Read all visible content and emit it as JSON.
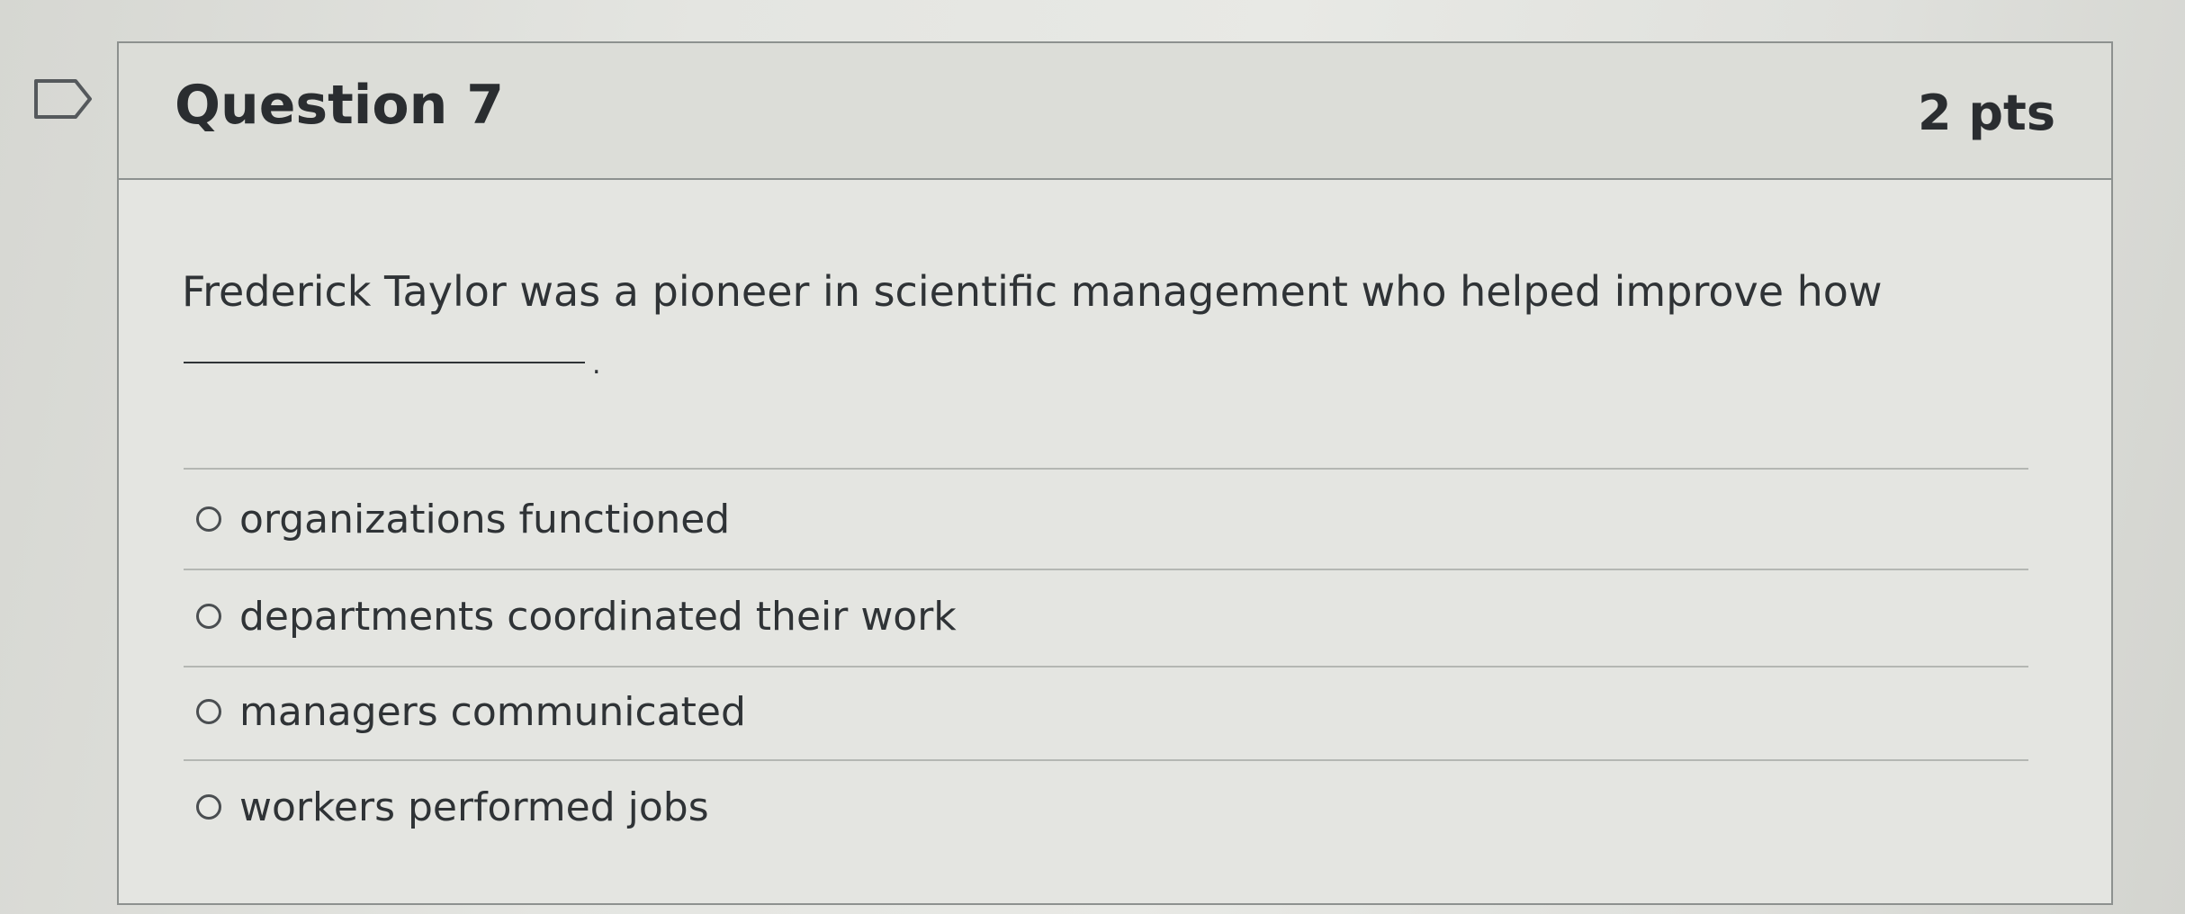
{
  "question": {
    "title": "Question 7",
    "points": "2 pts",
    "text": "Frederick Taylor was a pioneer in scientific management who helped improve how",
    "blank_suffix": "."
  },
  "answers": [
    {
      "label": "organizations functioned"
    },
    {
      "label": "departments coordinated their work"
    },
    {
      "label": "managers communicated"
    },
    {
      "label": "workers performed jobs"
    }
  ],
  "icons": {
    "flag": "bookmark-flag-icon",
    "radio": "radio-button-icon"
  }
}
